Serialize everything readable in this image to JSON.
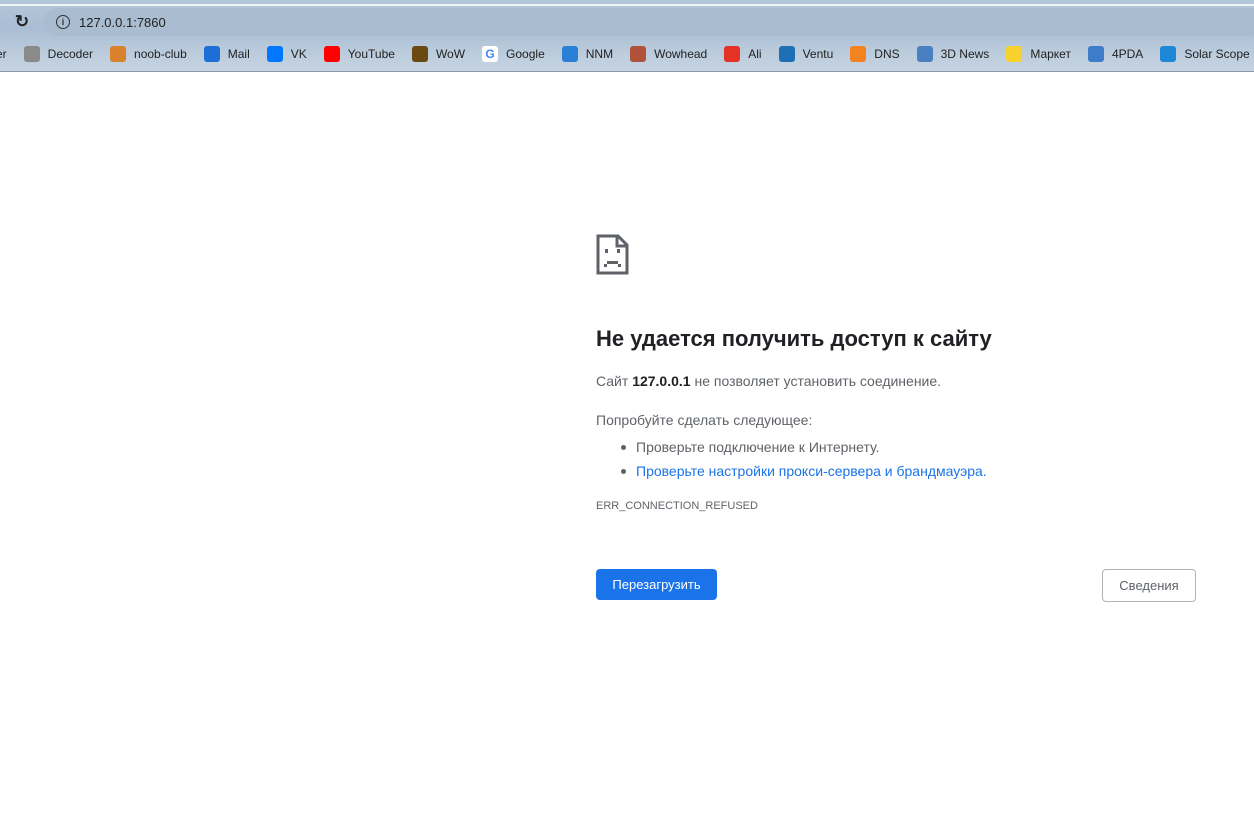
{
  "browser": {
    "url": "127.0.0.1:7860",
    "bookmarks": [
      {
        "label": "er",
        "icon": "none",
        "color": "transparent"
      },
      {
        "label": "Decoder",
        "icon": "zebra-icon",
        "color": "#8a8a8a"
      },
      {
        "label": "noob-club",
        "icon": "dragon-icon",
        "color": "#d9822b"
      },
      {
        "label": "Mail",
        "icon": "at-icon",
        "color": "#1d6fd6"
      },
      {
        "label": "VK",
        "icon": "vk-icon",
        "color": "#0077ff"
      },
      {
        "label": "YouTube",
        "icon": "youtube-icon",
        "color": "#ff0000"
      },
      {
        "label": "WoW",
        "icon": "wow-icon",
        "color": "#6b4a12"
      },
      {
        "label": "Google",
        "icon": "google-icon",
        "color": "#ffffff"
      },
      {
        "label": "NNM",
        "icon": "butterfly-icon",
        "color": "#2a7fd6"
      },
      {
        "label": "Wowhead",
        "icon": "wowhead-icon",
        "color": "#b0513a"
      },
      {
        "label": "Ali",
        "icon": "ali-icon",
        "color": "#e43225"
      },
      {
        "label": "Ventu",
        "icon": "ventu-icon",
        "color": "#1f6fb5"
      },
      {
        "label": "DNS",
        "icon": "dns-icon",
        "color": "#f58220"
      },
      {
        "label": "3D News",
        "icon": "3dnews-icon",
        "color": "#4a7fc1"
      },
      {
        "label": "Маркет",
        "icon": "market-icon",
        "color": "#f7d22e"
      },
      {
        "label": "4PDA",
        "icon": "4pda-icon",
        "color": "#3d7cc9"
      },
      {
        "label": "Solar Scope",
        "icon": "solar-scope-icon",
        "color": "#1e88d8"
      }
    ]
  },
  "error": {
    "title": "Не удается получить доступ к сайту",
    "site_prefix": "Сайт",
    "site": "127.0.0.1",
    "site_suffix": "не позволяет установить соединение.",
    "try_label": "Попробуйте сделать следующее:",
    "suggestions": [
      "Проверьте подключение к Интернету.",
      "Проверьте настройки прокси-сервера и брандмауэра."
    ],
    "code": "ERR_CONNECTION_REFUSED",
    "reload_button": "Перезагрузить",
    "details_button": "Сведения"
  }
}
